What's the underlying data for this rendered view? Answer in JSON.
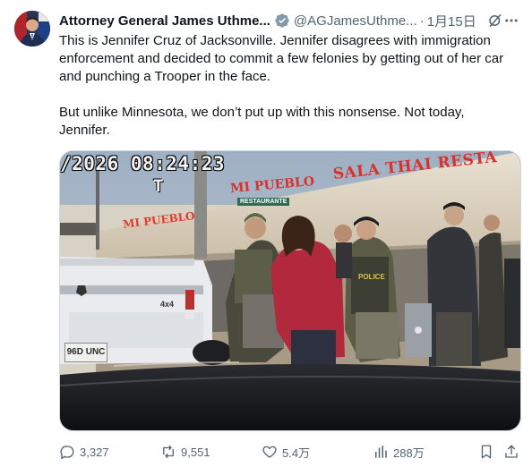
{
  "tweet": {
    "display_name": "Attorney General James Uthme...",
    "handle": "@AGJamesUthme...",
    "separator": "·",
    "timestamp": "1月15日",
    "verified_icon": "verified-badge-icon",
    "body": [
      "This is Jennifer Cruz of Jacksonville. Jennifer disagrees with immigration enforcement and decided to commit a few felonies by getting out of her car and punching a Trooper in the face.",
      "But unlike Minnesota, we don’t put up with this nonsense. Not today, Jennifer."
    ]
  },
  "media": {
    "timestamp_overlay": "/2026 08:24:23",
    "overlay_letter": "T",
    "signs": {
      "sala_thai": "SALA THAI RESTA",
      "mi_pueblo": "MI PUEBLO",
      "mi_pueblo_small": "MI PUEBLO",
      "restaurante": "RESTAURANTE"
    },
    "plate": "96D UNC",
    "truck_badge": "4x4",
    "vest_label": "POLICE"
  },
  "actions": {
    "reply_count": "3,327",
    "repost_count": "9,551",
    "like_count": "5.4万",
    "view_count": "288万"
  },
  "colors": {
    "text_primary": "#0f1419",
    "text_secondary": "#536471",
    "verified": "#829aab",
    "border": "#cfd9de"
  }
}
